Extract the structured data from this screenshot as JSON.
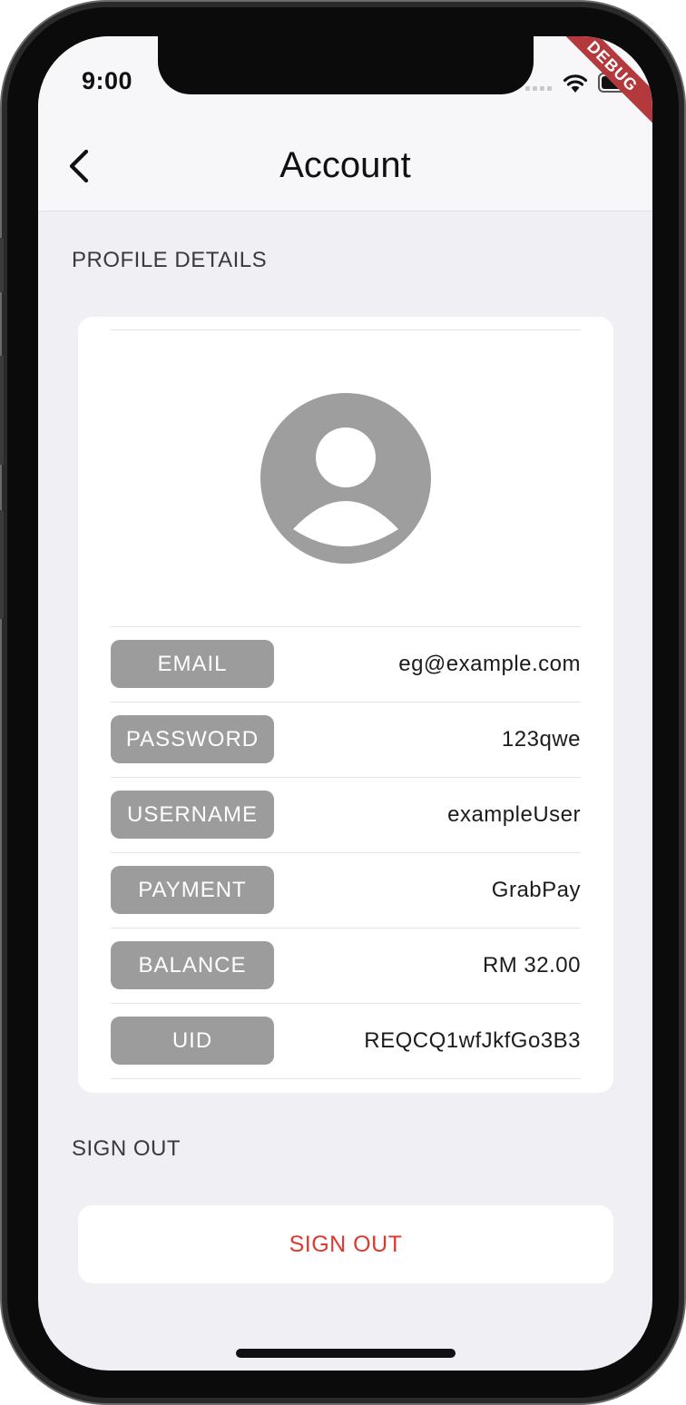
{
  "status_bar": {
    "time": "9:00",
    "debug_banner": "DEBUG"
  },
  "nav": {
    "title": "Account",
    "back_icon": "chevron-left-icon"
  },
  "profile": {
    "section_header": "PROFILE DETAILS",
    "avatar_icon": "person-avatar-icon",
    "fields": [
      {
        "label": "EMAIL",
        "value": "eg@example.com"
      },
      {
        "label": "PASSWORD",
        "value": "123qwe"
      },
      {
        "label": "USERNAME",
        "value": "exampleUser"
      },
      {
        "label": "PAYMENT",
        "value": "GrabPay"
      },
      {
        "label": "BALANCE",
        "value": "RM 32.00"
      },
      {
        "label": "UID",
        "value": "REQCQ1wfJkfGo3B3"
      }
    ]
  },
  "sign_out": {
    "section_header": "SIGN OUT",
    "button_label": "SIGN OUT"
  },
  "colors": {
    "screen_bg": "#efeff4",
    "card_bg": "#ffffff",
    "pill_bg": "#9c9c9c",
    "destructive": "#e0382c",
    "avatar_grey": "#9e9e9e"
  }
}
